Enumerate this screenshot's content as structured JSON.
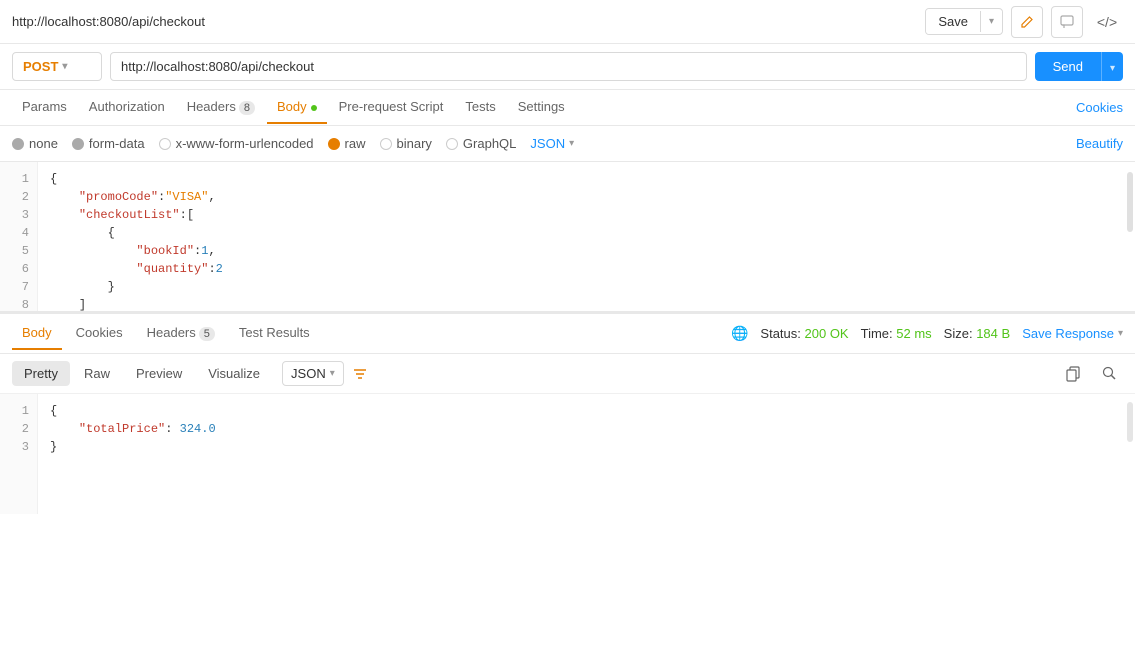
{
  "titleBar": {
    "url": "http://localhost:8080/api/checkout",
    "saveLabel": "Save",
    "codeIconLabel": "</>"
  },
  "requestBar": {
    "method": "POST",
    "url": "http://localhost:8080/api/checkout",
    "sendLabel": "Send"
  },
  "tabs": {
    "items": [
      {
        "id": "params",
        "label": "Params",
        "active": false
      },
      {
        "id": "authorization",
        "label": "Authorization",
        "active": false
      },
      {
        "id": "headers",
        "label": "Headers",
        "badge": "8",
        "active": false
      },
      {
        "id": "body",
        "label": "Body",
        "hasDot": true,
        "active": true
      },
      {
        "id": "prerequest",
        "label": "Pre-request Script",
        "active": false
      },
      {
        "id": "tests",
        "label": "Tests",
        "active": false
      },
      {
        "id": "settings",
        "label": "Settings",
        "active": false
      }
    ],
    "cookiesLink": "Cookies"
  },
  "bodyTypeBar": {
    "options": [
      {
        "id": "none",
        "label": "none"
      },
      {
        "id": "form-data",
        "label": "form-data"
      },
      {
        "id": "urlencoded",
        "label": "x-www-form-urlencoded"
      },
      {
        "id": "raw",
        "label": "raw",
        "selected": true
      },
      {
        "id": "binary",
        "label": "binary"
      },
      {
        "id": "graphql",
        "label": "GraphQL"
      }
    ],
    "jsonSelect": "JSON",
    "beautifyLabel": "Beautify"
  },
  "requestEditor": {
    "lines": [
      {
        "num": 1,
        "content": "{"
      },
      {
        "num": 2,
        "content": "    \"promoCode\":\"VISA\","
      },
      {
        "num": 3,
        "content": "    \"checkoutList\":["
      },
      {
        "num": 4,
        "content": "        {"
      },
      {
        "num": 5,
        "content": "            \"bookId\":1,"
      },
      {
        "num": 6,
        "content": "            \"quantity\":2"
      },
      {
        "num": 7,
        "content": "        }"
      },
      {
        "num": 8,
        "content": "    ]"
      }
    ]
  },
  "responseTabs": {
    "items": [
      {
        "id": "body",
        "label": "Body",
        "active": true
      },
      {
        "id": "cookies",
        "label": "Cookies"
      },
      {
        "id": "headers",
        "label": "Headers",
        "badge": "5"
      },
      {
        "id": "testresults",
        "label": "Test Results"
      }
    ],
    "status": {
      "statusText": "Status:",
      "statusCode": "200 OK",
      "timeText": "Time:",
      "timeValue": "52 ms",
      "sizeText": "Size:",
      "sizeValue": "184 B"
    },
    "saveResponse": "Save Response"
  },
  "responseFormatBar": {
    "tabs": [
      {
        "id": "pretty",
        "label": "Pretty",
        "active": true
      },
      {
        "id": "raw",
        "label": "Raw"
      },
      {
        "id": "preview",
        "label": "Preview"
      },
      {
        "id": "visualize",
        "label": "Visualize"
      }
    ],
    "formatSelect": "JSON"
  },
  "responseEditor": {
    "lines": [
      {
        "num": 1,
        "content": "{"
      },
      {
        "num": 2,
        "content": "    \"totalPrice\": 324.0"
      },
      {
        "num": 3,
        "content": "}"
      }
    ]
  }
}
